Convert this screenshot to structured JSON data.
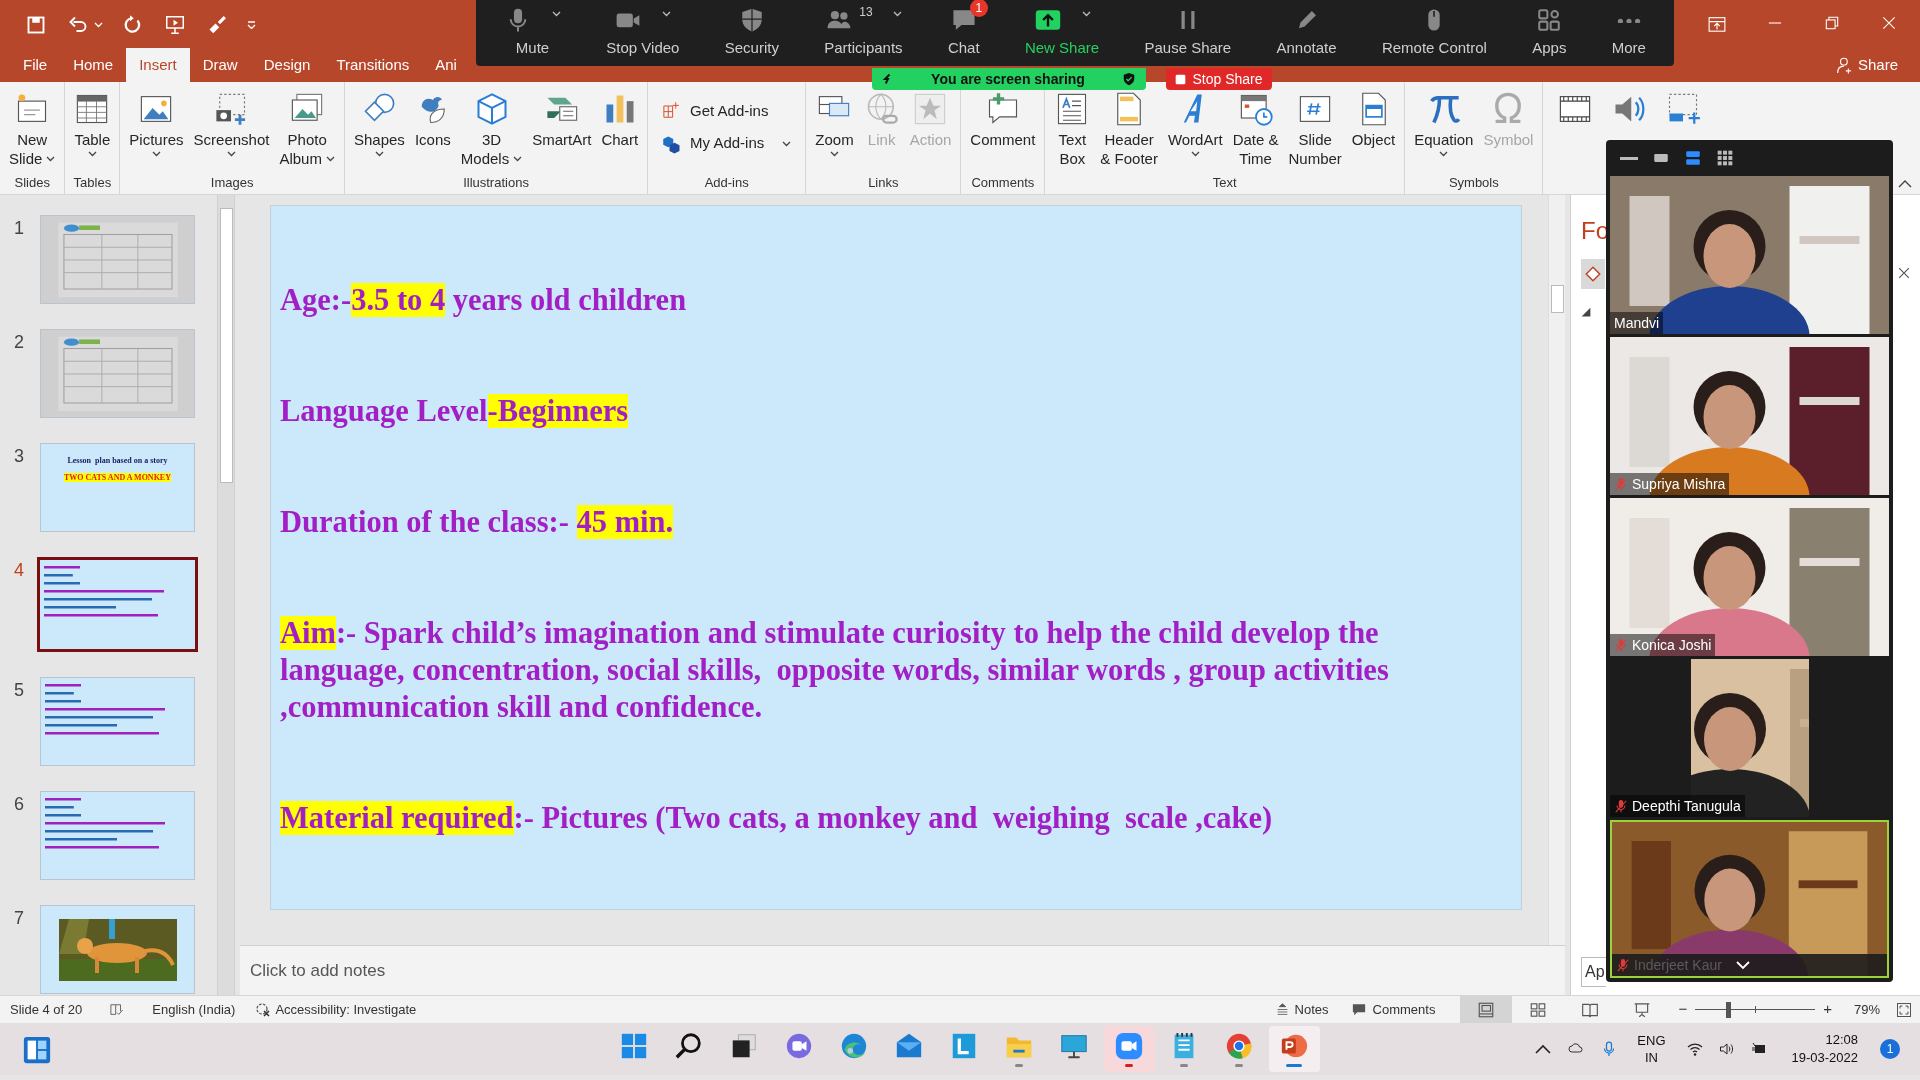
{
  "title_bar": {
    "share": "Share"
  },
  "tabs": [
    {
      "label": "File",
      "selected": false
    },
    {
      "label": "Home",
      "selected": false
    },
    {
      "label": "Insert",
      "selected": true
    },
    {
      "label": "Draw",
      "selected": false
    },
    {
      "label": "Design",
      "selected": false
    },
    {
      "label": "Transitions",
      "selected": false
    },
    {
      "label": "Ani",
      "selected": false
    }
  ],
  "ribbon": {
    "groups": [
      {
        "label": "Slides",
        "buttons": [
          {
            "kind": "large",
            "lines": [
              "New",
              "Slide"
            ],
            "dropdown": true,
            "disabled": false
          }
        ]
      },
      {
        "label": "Tables",
        "buttons": [
          {
            "kind": "large",
            "lines": [
              "Table"
            ],
            "dropdown": true,
            "disabled": false
          }
        ]
      },
      {
        "label": "Images",
        "buttons": [
          {
            "kind": "large",
            "lines": [
              "Pictures"
            ],
            "dropdown": true,
            "disabled": false
          },
          {
            "kind": "large",
            "lines": [
              "Screenshot"
            ],
            "dropdown": true,
            "disabled": false
          },
          {
            "kind": "large",
            "lines": [
              "Photo",
              "Album"
            ],
            "dropdown": true,
            "disabled": false
          }
        ]
      },
      {
        "label": "Illustrations",
        "buttons": [
          {
            "kind": "large",
            "lines": [
              "Shapes"
            ],
            "dropdown": true,
            "disabled": false
          },
          {
            "kind": "large",
            "lines": [
              "Icons"
            ],
            "dropdown": false,
            "disabled": false
          },
          {
            "kind": "large",
            "lines": [
              "3D",
              "Models"
            ],
            "dropdown": true,
            "disabled": false
          },
          {
            "kind": "large",
            "lines": [
              "SmartArt"
            ],
            "dropdown": false,
            "disabled": false
          },
          {
            "kind": "large",
            "lines": [
              "Chart"
            ],
            "dropdown": false,
            "disabled": false
          }
        ]
      },
      {
        "label": "Add-ins",
        "buttons": [
          {
            "kind": "small",
            "lines": [
              "Get Add-ins"
            ],
            "dropdown": false,
            "disabled": false
          },
          {
            "kind": "small",
            "lines": [
              "My Add-ins"
            ],
            "dropdown": true,
            "disabled": false
          }
        ]
      },
      {
        "label": "Links",
        "buttons": [
          {
            "kind": "large",
            "lines": [
              "Zoom"
            ],
            "dropdown": true,
            "disabled": false
          },
          {
            "kind": "large",
            "lines": [
              "Link"
            ],
            "dropdown": false,
            "disabled": true
          },
          {
            "kind": "large",
            "lines": [
              "Action"
            ],
            "dropdown": false,
            "disabled": true
          }
        ]
      },
      {
        "label": "Comments",
        "buttons": [
          {
            "kind": "large",
            "lines": [
              "Comment"
            ],
            "dropdown": false,
            "disabled": false
          }
        ]
      },
      {
        "label": "Text",
        "buttons": [
          {
            "kind": "large",
            "lines": [
              "Text",
              "Box"
            ],
            "dropdown": false,
            "disabled": false
          },
          {
            "kind": "large",
            "lines": [
              "Header",
              "& Footer"
            ],
            "dropdown": false,
            "disabled": false
          },
          {
            "kind": "large",
            "lines": [
              "WordArt"
            ],
            "dropdown": true,
            "disabled": false
          },
          {
            "kind": "large",
            "lines": [
              "Date &",
              "Time"
            ],
            "dropdown": false,
            "disabled": false
          },
          {
            "kind": "large",
            "lines": [
              "Slide",
              "Number"
            ],
            "dropdown": false,
            "disabled": false
          },
          {
            "kind": "large",
            "lines": [
              "Object"
            ],
            "dropdown": false,
            "disabled": false
          }
        ]
      },
      {
        "label": "Symbols",
        "buttons": [
          {
            "kind": "large",
            "lines": [
              "Equation"
            ],
            "dropdown": true,
            "disabled": false
          },
          {
            "kind": "large",
            "lines": [
              "Symbol"
            ],
            "dropdown": false,
            "disabled": true
          }
        ]
      }
    ]
  },
  "zoom_toolbar": {
    "items": [
      {
        "label": "Mute",
        "kind": "normal",
        "dropdown": true
      },
      {
        "label": "Stop Video",
        "kind": "normal",
        "dropdown": true
      },
      {
        "label": "Security",
        "kind": "normal",
        "dropdown": false
      },
      {
        "label": "Participants",
        "kind": "normal",
        "dropdown": true,
        "count": "13"
      },
      {
        "label": "Chat",
        "kind": "normal",
        "dropdown": false,
        "badge": "1"
      },
      {
        "label": "New Share",
        "kind": "primary",
        "dropdown": true
      },
      {
        "label": "Pause Share",
        "kind": "normal",
        "dropdown": false
      },
      {
        "label": "Annotate",
        "kind": "normal",
        "dropdown": false
      },
      {
        "label": "Remote Control",
        "kind": "normal",
        "dropdown": false
      },
      {
        "label": "Apps",
        "kind": "normal",
        "dropdown": false
      },
      {
        "label": "More",
        "kind": "normal",
        "dropdown": false
      }
    ],
    "banner": "You are screen sharing",
    "stop_share": "Stop Share"
  },
  "thumbnails": [
    {
      "number": "1",
      "kind": "picture",
      "selected": false
    },
    {
      "number": "2",
      "kind": "picture",
      "selected": false
    },
    {
      "number": "3",
      "kind": "title",
      "selected": false,
      "lines": [
        "Lesson  plan based on a story",
        "TWO CATS AND A MONKEY"
      ]
    },
    {
      "number": "4",
      "kind": "text",
      "selected": true
    },
    {
      "number": "5",
      "kind": "text",
      "selected": false
    },
    {
      "number": "6",
      "kind": "text",
      "selected": false
    },
    {
      "number": "7",
      "kind": "picture",
      "selected": false
    }
  ],
  "slide": {
    "paragraphs": [
      {
        "segments": [
          {
            "text": "Age:-",
            "highlight": false
          },
          {
            "text": "3.5 to 4",
            "highlight": true
          },
          {
            "text": " years old children",
            "highlight": false
          }
        ]
      },
      {
        "segments": [
          {
            "text": "Language Level",
            "highlight": false
          },
          {
            "text": "-Beginners",
            "highlight": true
          }
        ]
      },
      {
        "segments": [
          {
            "text": "Duration of the class:- ",
            "highlight": false
          },
          {
            "text": "45 min.",
            "highlight": true
          }
        ]
      },
      {
        "segments": [
          {
            "text": "Aim",
            "highlight": true
          },
          {
            "text": ":- Spark child’s imagination and stimulate curiosity to help the child develop the language, concentration, social skills,  opposite words, similar words , group activities ,communication skill and confidence.",
            "highlight": false
          }
        ]
      },
      {
        "segments": [
          {
            "text": "Material required",
            "highlight": true
          },
          {
            "text": ":- Pictures (Two cats, a monkey and  weighing  scale ,cake)",
            "highlight": false
          }
        ]
      }
    ]
  },
  "notes": {
    "placeholder": "Click to add notes"
  },
  "format_pane": {
    "title": "Fo",
    "button": "Ap"
  },
  "video_panel": {
    "tiles": [
      {
        "name": "Mandvi",
        "muted": false,
        "speaking": false
      },
      {
        "name": "Supriya Mishra",
        "muted": true,
        "speaking": false
      },
      {
        "name": "Konica Joshi",
        "muted": true,
        "speaking": false
      },
      {
        "name": "Deepthi Tanugula",
        "muted": true,
        "speaking": false
      },
      {
        "name": "Inderjeet Kaur",
        "muted": true,
        "speaking": true
      }
    ]
  },
  "status_bar": {
    "slide_info": "Slide 4 of 20",
    "language": "English (India)",
    "accessibility": "Accessibility: Investigate",
    "notes": "Notes",
    "comments": "Comments",
    "views": [
      {
        "selected": true
      },
      {
        "selected": false
      },
      {
        "selected": false
      },
      {
        "selected": false
      }
    ],
    "zoom_out": "−",
    "zoom_in": "+",
    "zoom": "79%",
    "level": 0.27
  },
  "taskbar": {
    "apps": [
      {
        "running": false,
        "attention": false,
        "active": false
      },
      {
        "running": false,
        "attention": false,
        "active": false
      },
      {
        "running": false,
        "attention": false,
        "active": false
      },
      {
        "running": false,
        "attention": false,
        "active": false
      },
      {
        "running": false,
        "attention": false,
        "active": false
      },
      {
        "running": false,
        "attention": false,
        "active": false
      },
      {
        "running": false,
        "attention": false,
        "active": false
      },
      {
        "running": true,
        "attention": false,
        "active": false
      },
      {
        "running": false,
        "attention": false,
        "active": false
      },
      {
        "running": true,
        "attention": true,
        "active": false
      },
      {
        "running": true,
        "attention": false,
        "active": false
      },
      {
        "running": true,
        "attention": false,
        "active": false
      },
      {
        "running": true,
        "attention": false,
        "active": true
      }
    ],
    "language": [
      "ENG",
      "IN"
    ],
    "time": "12:08",
    "date": "19-03-2022",
    "notification_count": "1"
  }
}
